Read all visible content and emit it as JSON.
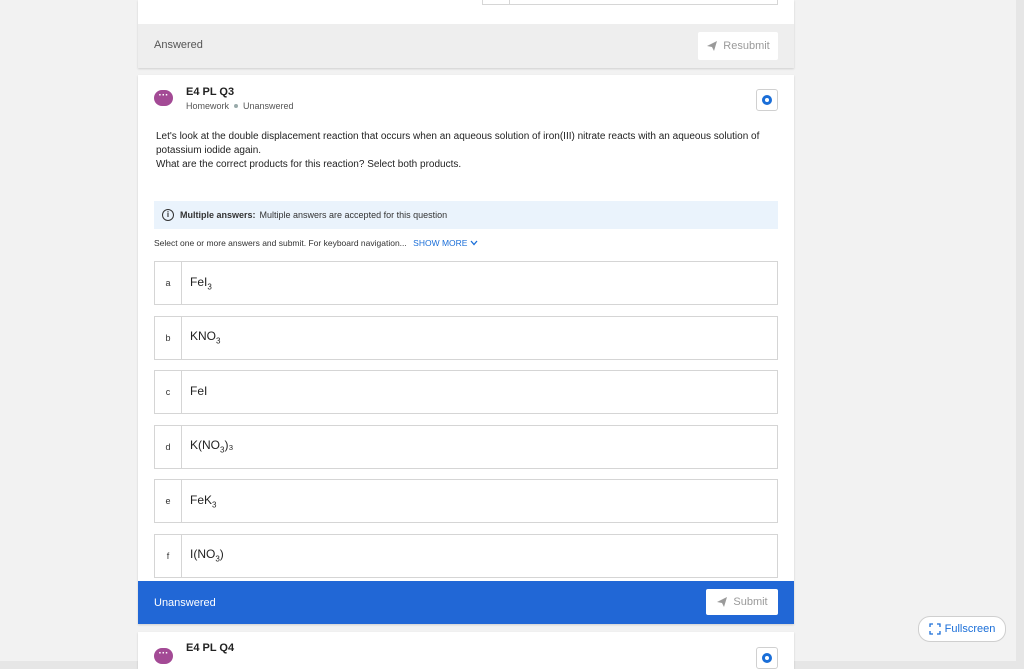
{
  "prev_card": {
    "status": "Answered",
    "resubmit_label": "Resubmit"
  },
  "question": {
    "title": "E4 PL Q3",
    "type": "Homework",
    "state": "Unanswered",
    "text_line1": "Let's look at the double displacement reaction that occurs when an aqueous solution of iron(III) nitrate reacts with an aqueous solution of potassium iodide again.",
    "text_line2": "What are the correct products for this reaction? Select both products.",
    "info_bold": "Multiple answers:",
    "info_text": "Multiple answers are accepted for this question",
    "instructions": "Select one or more answers and submit. For keyboard navigation...",
    "show_more": "SHOW MORE",
    "options": [
      {
        "letter": "a",
        "pre": "FeI",
        "sub": "3",
        "post": ""
      },
      {
        "letter": "b",
        "pre": "KNO",
        "sub": "3",
        "post": ""
      },
      {
        "letter": "c",
        "pre": "FeI",
        "sub": "",
        "post": ""
      },
      {
        "letter": "d",
        "pre": "K(NO",
        "sub": "3",
        "post": ")₃"
      },
      {
        "letter": "e",
        "pre": "FeK",
        "sub": "3",
        "post": ""
      },
      {
        "letter": "f",
        "pre": "I(NO",
        "sub": "3",
        "post": ")"
      }
    ],
    "footer_status": "Unanswered",
    "submit_label": "Submit"
  },
  "next_card": {
    "title": "E4 PL Q4"
  },
  "fullscreen_label": "Fullscreen",
  "colors": {
    "accent": "#2167d6",
    "chat_icon": "#a34a95",
    "info_bg": "#eaf3fc"
  },
  "icons": [
    "send-icon",
    "chat-bubble-icon",
    "gear-icon",
    "info-icon",
    "chevron-down-icon",
    "fullscreen-icon"
  ]
}
